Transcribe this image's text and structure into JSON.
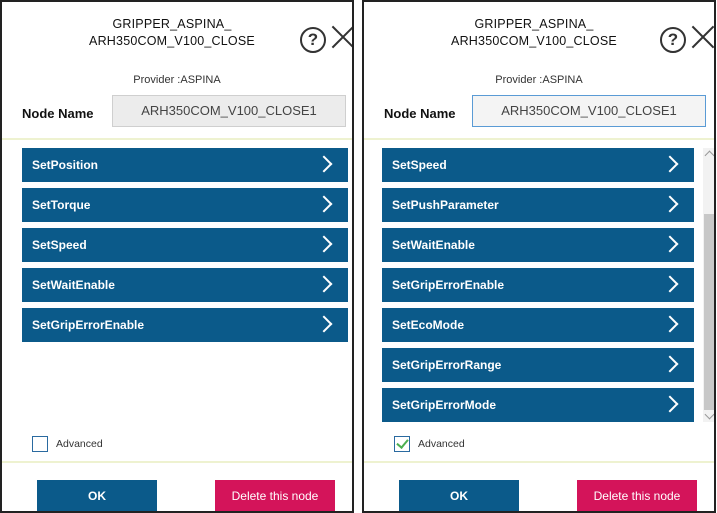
{
  "left_panel": {
    "title_line1": "GRIPPER_ASPINA_",
    "title_line2": "ARH350COM_V100_CLOSE",
    "help_glyph": "?",
    "provider": "Provider :ASPINA",
    "node_name_label": "Node Name",
    "node_name_value": "ARH350COM_V100_CLOSE1",
    "items": [
      {
        "label": "SetPosition"
      },
      {
        "label": "SetTorque"
      },
      {
        "label": "SetSpeed"
      },
      {
        "label": "SetWaitEnable"
      },
      {
        "label": "SetGripErrorEnable"
      }
    ],
    "advanced_label": "Advanced",
    "advanced_checked": false,
    "ok_label": "OK",
    "delete_label": "Delete this node"
  },
  "right_panel": {
    "title_line1": "GRIPPER_ASPINA_",
    "title_line2": "ARH350COM_V100_CLOSE",
    "help_glyph": "?",
    "provider": "Provider :ASPINA",
    "node_name_label": "Node Name",
    "node_name_value": "ARH350COM_V100_CLOSE1",
    "items": [
      {
        "label": "SetSpeed"
      },
      {
        "label": "SetPushParameter"
      },
      {
        "label": "SetWaitEnable"
      },
      {
        "label": "SetGripErrorEnable"
      },
      {
        "label": "SetEcoMode"
      },
      {
        "label": "SetGripErrorRange"
      },
      {
        "label": "SetGripErrorMode"
      }
    ],
    "advanced_label": "Advanced",
    "advanced_checked": true,
    "ok_label": "OK",
    "delete_label": "Delete this node"
  },
  "colors": {
    "item_blue": "#0b5a8a",
    "delete_pink": "#d4145a",
    "check_green": "#4caf50"
  }
}
